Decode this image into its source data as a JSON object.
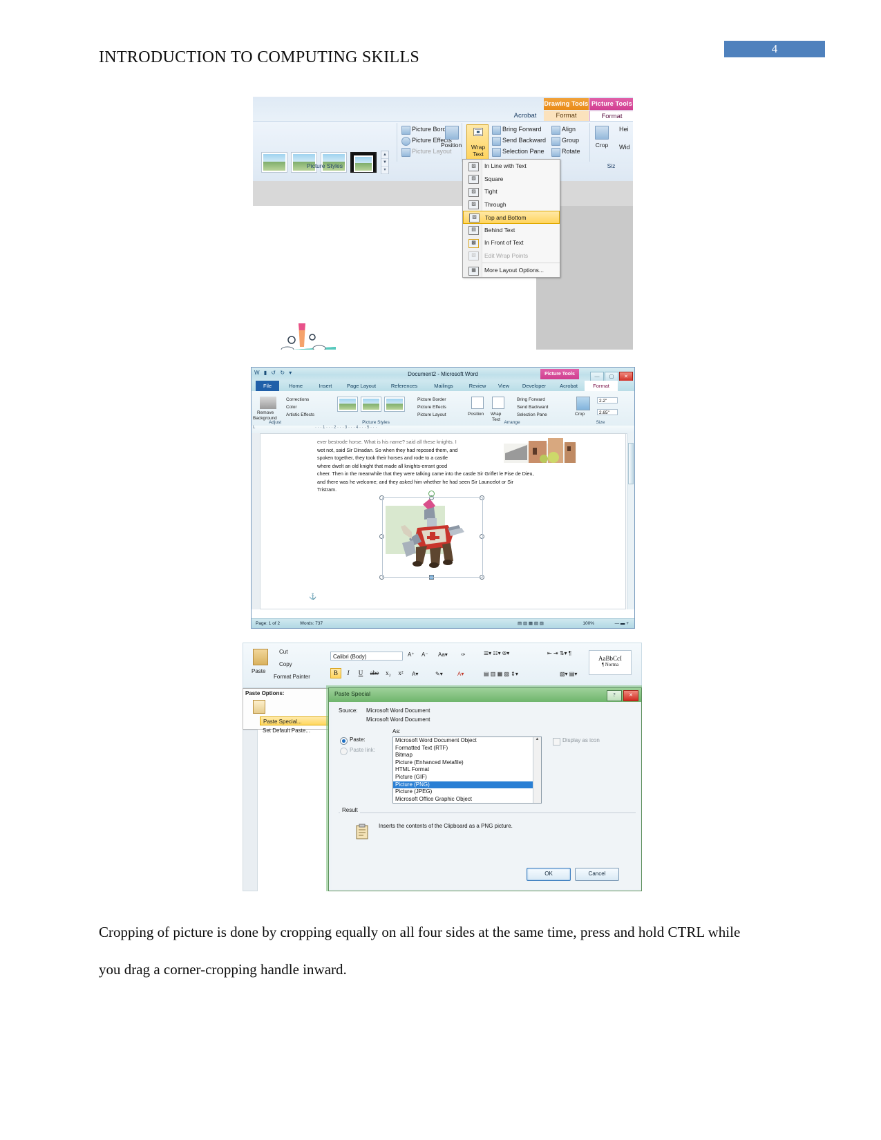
{
  "page": {
    "header_title": "INTRODUCTION TO COMPUTING SKILLS",
    "page_number": "4",
    "accent_color": "#4f81bd",
    "body_paragraph": "Cropping of picture is done by cropping equally on all four sides at the same time, press and hold CTRL while you drag a corner-cropping handle inward."
  },
  "shot1": {
    "context_tabs": [
      {
        "label": "Drawing Tools",
        "tab": "Format"
      },
      {
        "label": "Picture Tools",
        "tab": "Format"
      }
    ],
    "tabs": [
      "Acrobat",
      "Format",
      "Format"
    ],
    "groups": {
      "picture_styles": "Picture Styles",
      "size": "Siz"
    },
    "commands": [
      "Picture Border",
      "Picture Effects",
      "Picture Layout",
      "Bring Forward",
      "Send Backward",
      "Selection Pane",
      "Align",
      "Group",
      "Rotate"
    ],
    "big_buttons": {
      "position": "Position",
      "wrap_text_line1": "Wrap",
      "wrap_text_line2": "Text",
      "crop": "Crop",
      "height": "Hei",
      "width": "Wid"
    },
    "menu_items": [
      {
        "label": "In Line with Text",
        "state": "normal"
      },
      {
        "label": "Square",
        "state": "normal"
      },
      {
        "label": "Tight",
        "state": "normal"
      },
      {
        "label": "Through",
        "state": "normal"
      },
      {
        "label": "Top and Bottom",
        "state": "selected"
      },
      {
        "label": "Behind Text",
        "state": "normal"
      },
      {
        "label": "In Front of Text",
        "state": "normal"
      },
      {
        "label": "Edit Wrap Points",
        "state": "disabled"
      },
      {
        "label": "More Layout Options...",
        "state": "normal"
      }
    ]
  },
  "shot2": {
    "window_title": "Document2  -  Microsoft Word",
    "context_tab_label": "Picture Tools",
    "tabs": [
      "File",
      "Home",
      "Insert",
      "Page Layout",
      "References",
      "Mailings",
      "Review",
      "View",
      "Developer",
      "Acrobat",
      "Format"
    ],
    "ribbon_commands": [
      "Corrections",
      "Color",
      "Artistic Effects",
      "Picture Border",
      "Picture Effects",
      "Picture Layout",
      "Bring Forward",
      "Send Backward",
      "Selection Pane"
    ],
    "ribbon_buttons": {
      "remove_background_line1": "Remove",
      "remove_background_line2": "Background",
      "position": "Position",
      "wrap_line1": "Wrap",
      "wrap_line2": "Text",
      "crop": "Crop"
    },
    "group_labels": [
      "Adjust",
      "Picture Styles",
      "Arrange",
      "Size"
    ],
    "size_fields": {
      "height": "2.2\"",
      "width": "2.65\""
    },
    "document_text_lines": [
      "ever bestrode horse. What is his name? said all these knights. I",
      "wot not, said Sir Dinadan.  So when they had reposed them, and",
      "spoken together, they took their horses and rode to a castle",
      "where dwelt an old knight that made all knights-errant good",
      "cheer.  Then in the meanwhile that they were talking came into the castle Sir Griflet le Fise de Dieu,",
      "and there was he welcome; and they asked him whether he had seen Sir Launcelot or Sir",
      "Tristram."
    ],
    "status_bar": {
      "page": "Page: 1 of 2",
      "words": "Words: 737",
      "zoom": "100%"
    }
  },
  "shot3": {
    "home_commands": [
      "Cut",
      "Copy",
      "Format Painter"
    ],
    "paste_label": "Paste",
    "font_name": "Calibri (Body)",
    "format_buttons": [
      "B",
      "I",
      "U",
      "abe",
      "x₂",
      "x²"
    ],
    "style_gallery_label": "AaBbCcI",
    "style_name": "¶ Norma",
    "paste_options": {
      "title": "Paste Options:",
      "items": [
        {
          "label": "Paste Special...",
          "state": "selected"
        },
        {
          "label": "Set Default Paste...",
          "state": "normal"
        }
      ]
    },
    "dialog": {
      "title": "Paste Special",
      "help_button": "?",
      "close_button": "✕",
      "source_label": "Source:",
      "source_value_line1": "Microsoft Word Document",
      "source_value_line2": "Microsoft Word Document",
      "as_label": "As:",
      "paste_label": "Paste:",
      "paste_link_label": "Paste link:",
      "display_as_icon_label": "Display as icon",
      "list_items": [
        "Microsoft Word Document Object",
        "Formatted Text (RTF)",
        "Bitmap",
        "Picture (Enhanced Metafile)",
        "HTML Format",
        "Picture (GIF)",
        "Picture (PNG)",
        "Picture (JPEG)",
        "Microsoft Office Graphic Object"
      ],
      "selected_list_item": "Picture (PNG)",
      "result_label": "Result",
      "result_text": "Inserts the contents of the Clipboard as a PNG picture.",
      "ok_button": "OK",
      "cancel_button": "Cancel"
    }
  }
}
